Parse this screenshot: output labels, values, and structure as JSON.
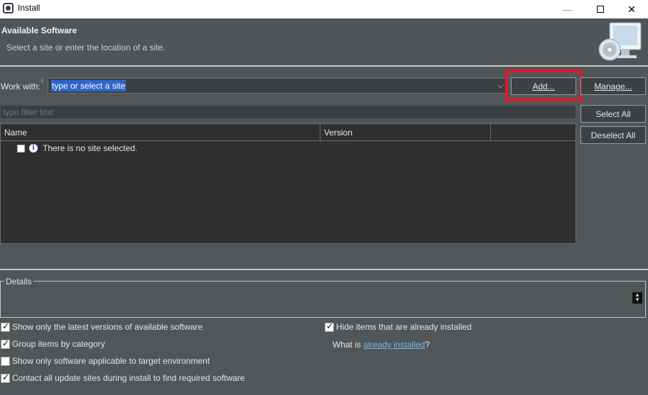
{
  "window": {
    "title": "Install",
    "minimize_glyph": "—",
    "close_glyph": "✕"
  },
  "header": {
    "title": "Available Software",
    "subtitle": "Select a site or enter the location of a site."
  },
  "work_with": {
    "label": "Work with:",
    "info_marker": "i",
    "value": "type or select a site",
    "arrow": "⌵"
  },
  "buttons": {
    "add": "Add...",
    "manage": "Manage...",
    "select_all": "Select All",
    "deselect_all": "Deselect All"
  },
  "filter": {
    "placeholder": "type filter text"
  },
  "table": {
    "columns": [
      "Name",
      "Version",
      ""
    ],
    "rows": [
      {
        "checked": false,
        "icon": "info-icon",
        "text": "There is no site selected."
      }
    ]
  },
  "details": {
    "label": "Details"
  },
  "options": {
    "show_latest": {
      "label": "Show only the latest versions of available software",
      "checked": true
    },
    "group_by_category": {
      "label": "Group items by category",
      "checked": true
    },
    "target_env": {
      "label": "Show only software applicable to target environment",
      "checked": false
    },
    "contact_sites": {
      "label": "Contact all update sites during install to find required software",
      "checked": true
    },
    "hide_installed": {
      "label": "Hide items that are already installed",
      "checked": true
    }
  },
  "what_is": {
    "prefix": "What is ",
    "link": "already installed",
    "suffix": "?"
  },
  "colors": {
    "background": "#515658",
    "highlight": "#e5162a",
    "selection": "#2f65ca",
    "link": "#6fb7f2"
  }
}
